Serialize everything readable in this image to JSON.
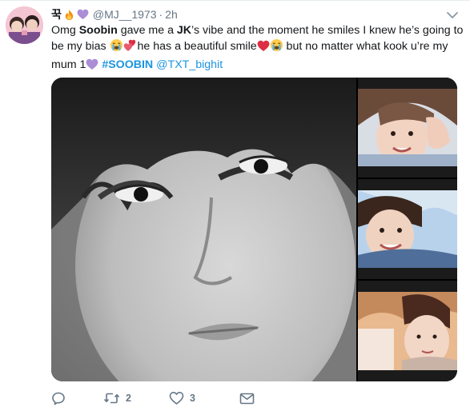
{
  "tweet": {
    "display_name": "꾹",
    "handle": "@MJ__1973",
    "separator": "·",
    "time": "2h",
    "text": {
      "p1": "Omg ",
      "b1": "Soobin",
      "p2": " gave me a ",
      "b2": "JK",
      "p3": "’s vibe and the moment he smiles I knew he’s going to be my bias ",
      "p4": "he has a beautiful smile",
      "p5": " but no matter what kook u’re my mum 1",
      "hashtag": "#SOOBIN",
      "mention": "@TXT_bighit"
    }
  },
  "icons": {
    "header_emoji": [
      "fire-icon",
      "purple-heart-icon"
    ],
    "inline_emoji": [
      "crying-face-icon",
      "two-hearts-icon",
      "red-heart-icon",
      "crying-face-icon",
      "purple-heart-icon"
    ]
  },
  "actions": {
    "reply_count": "",
    "retweet_count": "2",
    "like_count": "3"
  },
  "colors": {
    "link": "#1b95e0",
    "muted": "#657786",
    "border": "#e6ecf0"
  }
}
